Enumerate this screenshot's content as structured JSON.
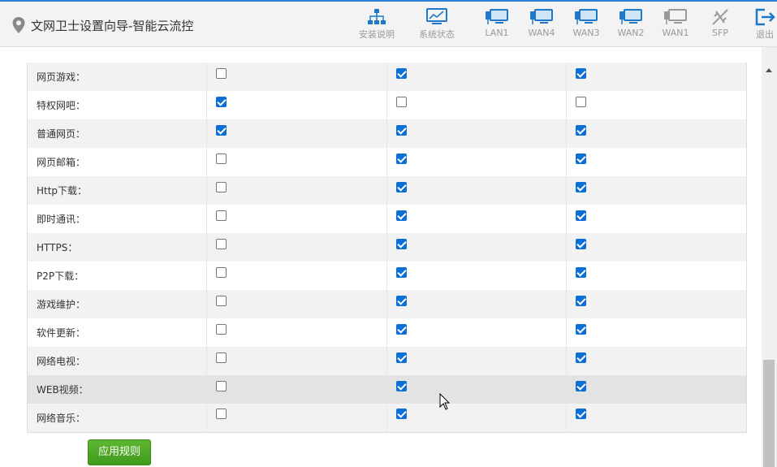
{
  "header": {
    "title": "文网卫士设置向导-智能云流控",
    "icon": "location-pin-icon"
  },
  "toolbar": [
    {
      "label": "安装说明",
      "icon": "network-tree-icon"
    },
    {
      "label": "系统状态",
      "icon": "monitor-chart-icon"
    },
    {
      "label": "LAN1",
      "icon": "port-monitor-icon"
    },
    {
      "label": "WAN4",
      "icon": "port-monitor-icon"
    },
    {
      "label": "WAN3",
      "icon": "port-monitor-icon"
    },
    {
      "label": "WAN2",
      "icon": "port-monitor-icon"
    },
    {
      "label": "WAN1",
      "icon": "port-monitor-disabled-icon"
    },
    {
      "label": "SFP",
      "icon": "sfp-disabled-icon"
    },
    {
      "label": "退出",
      "icon": "logout-icon"
    }
  ],
  "rules": [
    {
      "name": "网页游戏：",
      "checks": [
        false,
        true,
        true
      ]
    },
    {
      "name": "特权网吧：",
      "checks": [
        true,
        false,
        false
      ]
    },
    {
      "name": "普通网页：",
      "checks": [
        true,
        true,
        true
      ]
    },
    {
      "name": "网页邮箱：",
      "checks": [
        false,
        true,
        true
      ]
    },
    {
      "name": "Http下载：",
      "checks": [
        false,
        true,
        true
      ]
    },
    {
      "name": "即时通讯：",
      "checks": [
        false,
        true,
        true
      ]
    },
    {
      "name": "HTTPS：",
      "checks": [
        false,
        true,
        true
      ]
    },
    {
      "name": "P2P下载：",
      "checks": [
        false,
        true,
        true
      ]
    },
    {
      "name": "游戏维护：",
      "checks": [
        false,
        true,
        true
      ]
    },
    {
      "name": "软件更新：",
      "checks": [
        false,
        true,
        true
      ]
    },
    {
      "name": "网络电视：",
      "checks": [
        false,
        true,
        true
      ]
    },
    {
      "name": "WEB视频：",
      "checks": [
        false,
        true,
        true
      ],
      "hover": true
    },
    {
      "name": "网络音乐：",
      "checks": [
        false,
        true,
        true
      ]
    }
  ],
  "apply_button": "应用规则",
  "colors": {
    "accent": "#0b6fd6",
    "apply": "#4fa826",
    "header_border": "#2e7fd6"
  }
}
